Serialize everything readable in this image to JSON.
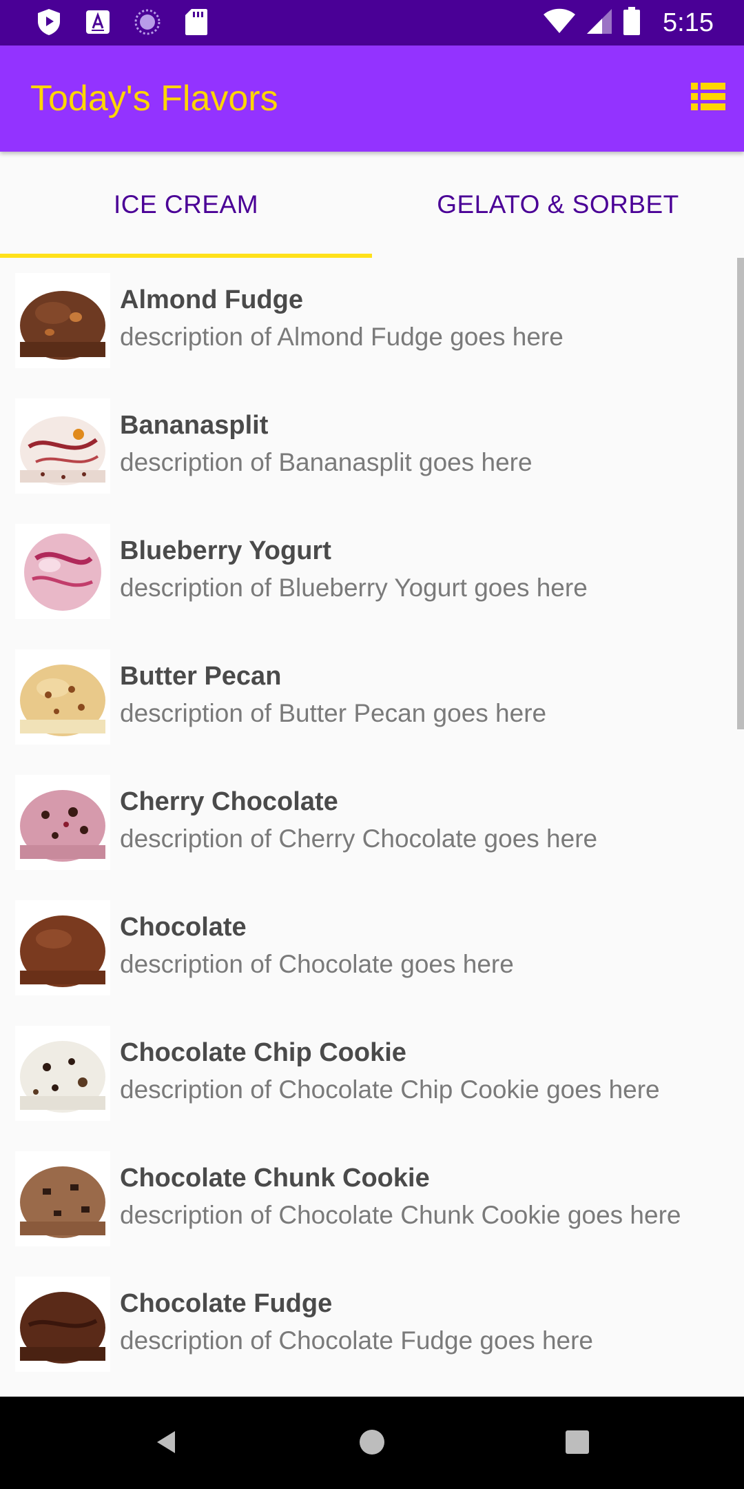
{
  "status_bar": {
    "time": "5:15",
    "icons": [
      "play-protect-icon",
      "a-notification-icon",
      "loading-icon",
      "sd-card-icon",
      "wifi-icon",
      "signal-icon",
      "battery-icon"
    ]
  },
  "app_bar": {
    "title": "Today's Flavors",
    "menu_icon": "list-view-icon"
  },
  "tabs": [
    {
      "label": "ICE CREAM",
      "selected": true
    },
    {
      "label": "GELATO & SORBET",
      "selected": false
    }
  ],
  "flavors": [
    {
      "name": "Almond Fudge",
      "description": "description of Almond Fudge goes here"
    },
    {
      "name": "Bananasplit",
      "description": "description of Bananasplit goes here"
    },
    {
      "name": "Blueberry Yogurt",
      "description": "description of Blueberry Yogurt goes here"
    },
    {
      "name": "Butter Pecan",
      "description": "description of Butter Pecan goes here"
    },
    {
      "name": "Cherry Chocolate",
      "description": "description of Cherry Chocolate goes here"
    },
    {
      "name": "Chocolate",
      "description": "description of Chocolate goes here"
    },
    {
      "name": "Chocolate Chip Cookie",
      "description": "description of Chocolate Chip Cookie goes here"
    },
    {
      "name": "Chocolate Chunk Cookie",
      "description": "description of Chocolate Chunk Cookie goes here"
    },
    {
      "name": "Chocolate Fudge",
      "description": "description of Chocolate Fudge goes here"
    }
  ],
  "colors": {
    "status_bar": "#4a0096",
    "app_bar": "#9333ff",
    "title": "#ffd600",
    "tab_text": "#4a0096",
    "tab_indicator": "#ffe11a"
  },
  "nav_bar": {
    "icons": [
      "back-icon",
      "home-icon",
      "recents-icon"
    ]
  }
}
